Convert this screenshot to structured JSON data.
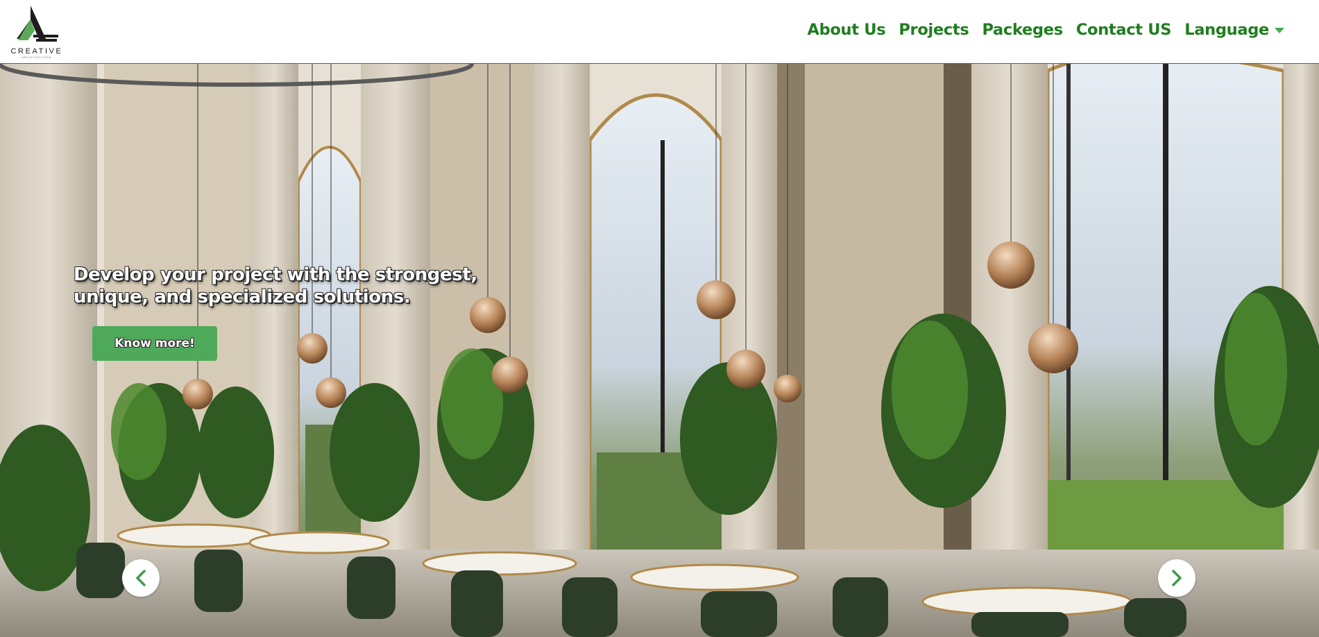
{
  "brand": {
    "name": "CREATIVE",
    "sub": "ARCHITECTURE",
    "logo_icon": "triangle-logo-icon"
  },
  "nav": {
    "items": [
      "About Us",
      "Projects",
      "Packeges",
      "Contact US"
    ],
    "language_label": "Language",
    "language_icon": "caret-down-icon"
  },
  "hero": {
    "tagline_line1": "Develop your project with the strongest,",
    "tagline_line2": "unique, and specialized solutions.",
    "cta_label": "Know more!",
    "prev_icon": "chevron-left-icon",
    "next_icon": "chevron-right-icon"
  },
  "colors": {
    "nav_text": "#1f7d1f",
    "button_bg": "#4fa95b",
    "logo_green": "#5aaa5a",
    "logo_dark": "#1d1d1d"
  }
}
